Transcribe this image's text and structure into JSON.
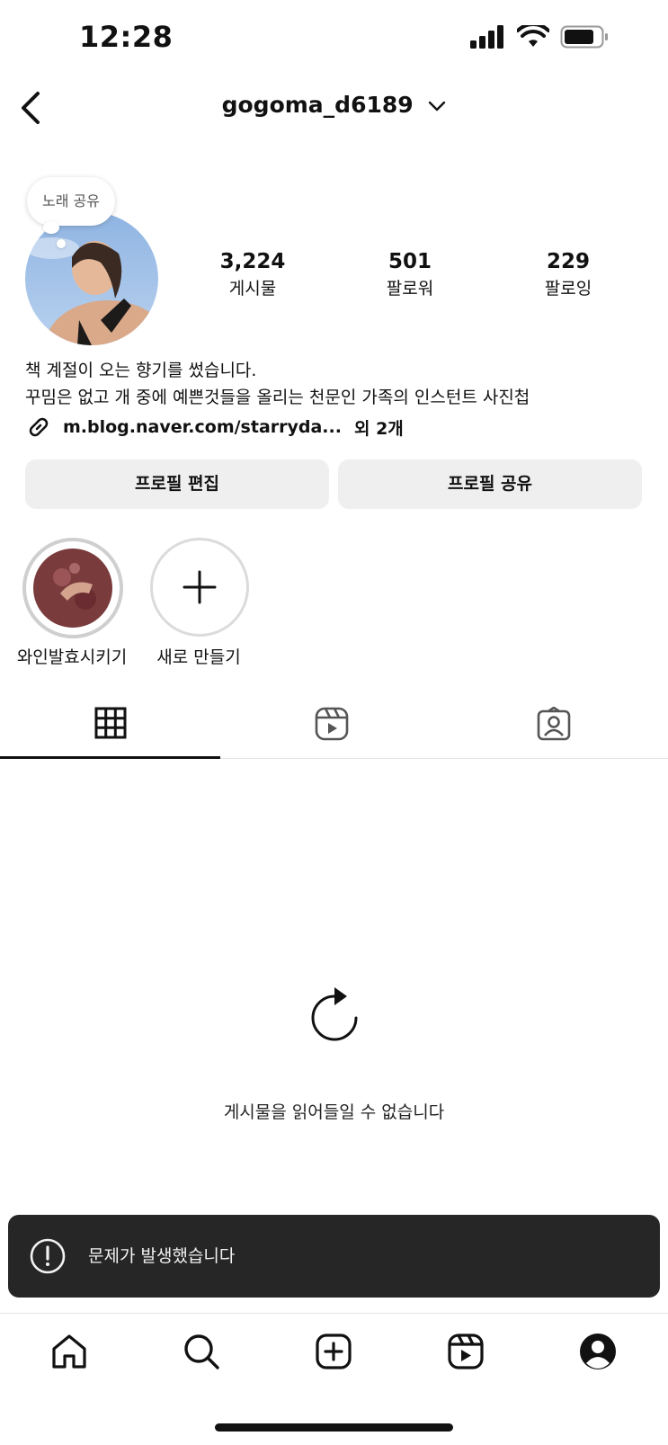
{
  "status_bar": {
    "time": "12:28"
  },
  "header": {
    "username": "gogoma_d6189"
  },
  "profile": {
    "note_bubble": "노래 공유",
    "stats": [
      {
        "value": "3,224",
        "label": "게시물"
      },
      {
        "value": "501",
        "label": "팔로워"
      },
      {
        "value": "229",
        "label": "팔로잉"
      }
    ],
    "bio_lines": [
      "책 계절이 오는 향기를 썼습니다.",
      "꾸밈은 없고 개 중에 예쁜것들을 올리는 천문인 가족의 인스턴트 사진첩"
    ],
    "link_url": "m.blog.naver.com/starryda...",
    "link_more": "외 2개"
  },
  "buttons": {
    "edit_profile": "프로필 편집",
    "share_profile": "프로필 공유"
  },
  "highlights": [
    {
      "label": "와인발효시키기"
    },
    {
      "label": "새로 만들기"
    }
  ],
  "feed": {
    "error_message": "게시물을 읽어들일 수 없습니다"
  },
  "toast": {
    "message": "문제가 발생했습니다"
  },
  "colors": {
    "toast_bg": "#262626",
    "button_bg": "#efefef",
    "text": "#111111"
  }
}
